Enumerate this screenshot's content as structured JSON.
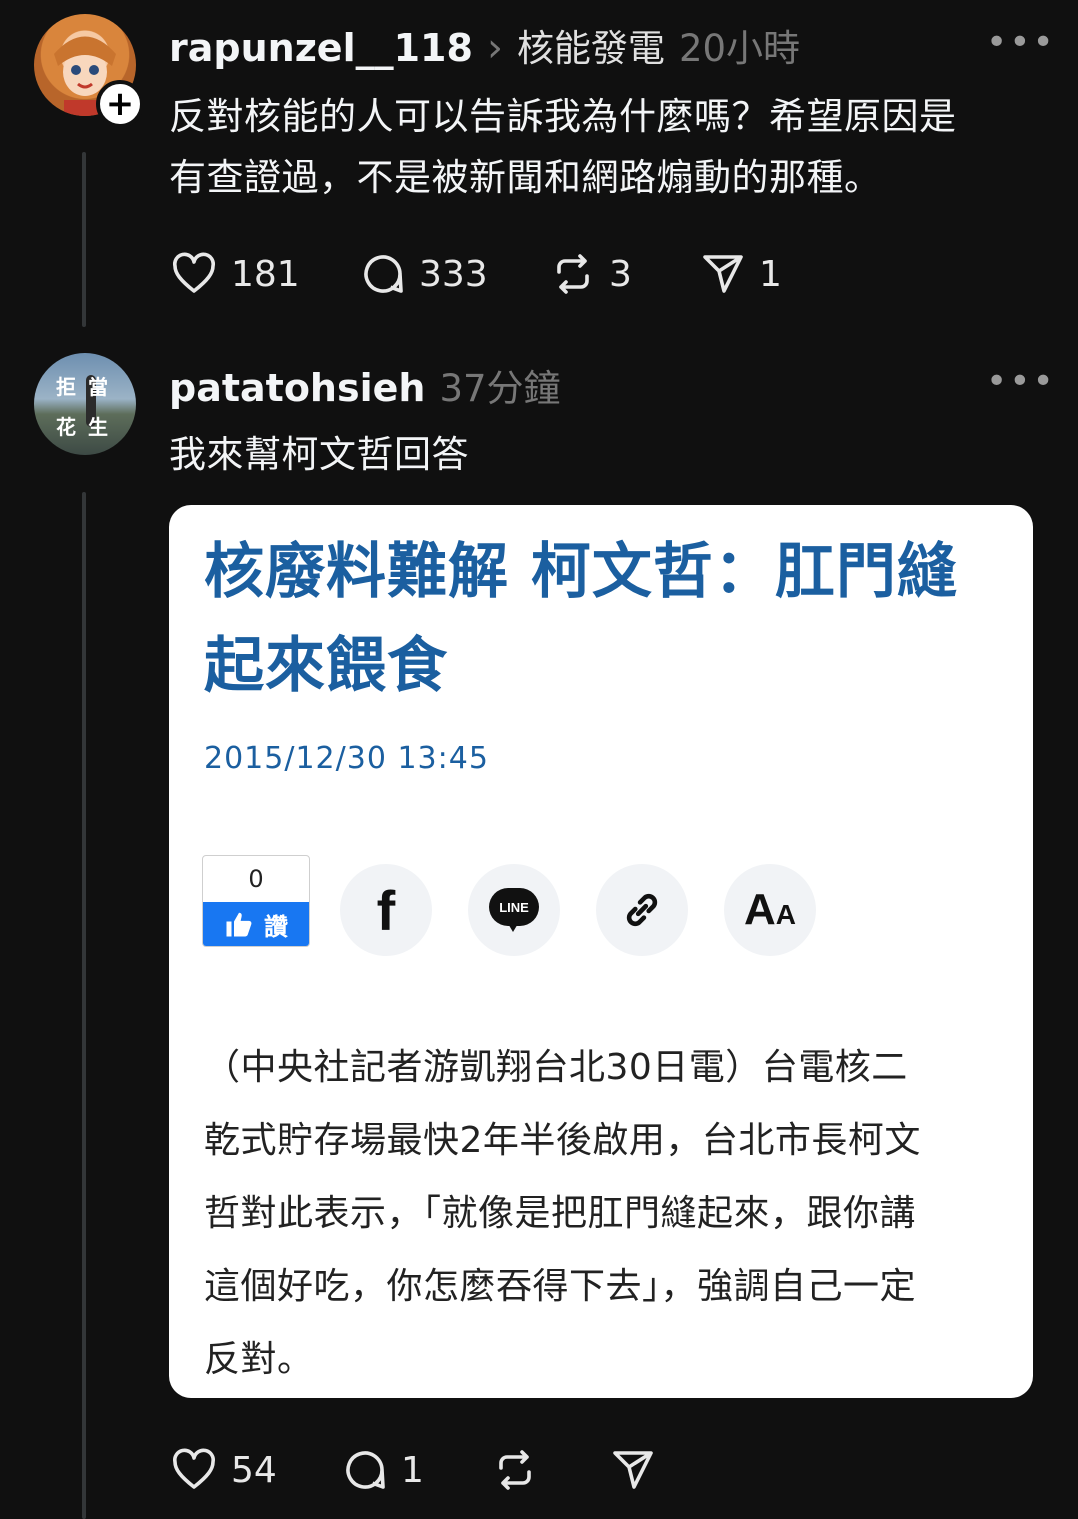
{
  "post1": {
    "username": "rapunzel__118",
    "topic_separator": "›",
    "topic": "核能發電",
    "time": "20小時",
    "text_line1": "反對核能的人可以告訴我為什麼嗎？希望原因是",
    "text_line2": "有查證過，不是被新聞和網路煽動的那種。",
    "more": "•••",
    "follow": "+",
    "actions": {
      "likes": "181",
      "replies": "333",
      "reposts": "3",
      "shares": "1"
    }
  },
  "post2": {
    "username": "patatohsieh",
    "time": "37分鐘",
    "avatar_text": [
      "拒",
      "當",
      "花",
      "生"
    ],
    "text": "我來幫柯文哲回答",
    "more": "•••",
    "actions": {
      "likes": "54",
      "replies": "1"
    }
  },
  "article": {
    "title_line1": "核廢料難解 柯文哲：肛門縫",
    "title_line2": "起來餵食",
    "date": "2015/12/30 13:45",
    "like_count": "0",
    "like_label": "讚",
    "share_icons": [
      "facebook-icon",
      "line-icon",
      "link-icon",
      "font-size-icon"
    ],
    "facebook_glyph": "f",
    "line_glyph": "LINE",
    "font_glyph_big": "A",
    "font_glyph_small": "A",
    "body": [
      "（中央社記者游凱翔台北30日電）台電核二",
      "乾式貯存場最快2年半後啟用，台北市長柯文",
      "哲對此表示，「就像是把肛門縫起來，跟你講",
      "這個好吃，你怎麼吞得下去」，強調自己一定",
      "反對。"
    ]
  },
  "colors": {
    "background": "#101010",
    "article_blue": "#1b5fa0",
    "fb_like_blue": "#1877f2"
  }
}
